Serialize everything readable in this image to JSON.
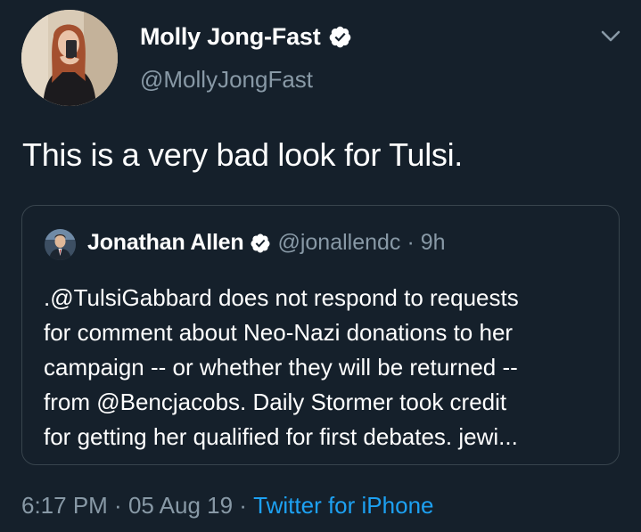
{
  "tweet": {
    "author": {
      "display_name": "Molly Jong-Fast",
      "handle": "@MollyJongFast",
      "verified_icon": "verified-badge-icon"
    },
    "text": "This is a very bad look for Tulsi.",
    "quoted": {
      "display_name": "Jonathan Allen",
      "handle": "@jonallendc",
      "separator": "·",
      "time": "9h",
      "lines": [
        ".@TulsiGabbard does not respond to requests",
        "for comment about Neo-Nazi donations to her",
        "campaign -- or whether they will be returned --",
        "from @Bencjacobs. Daily Stormer took credit",
        "for getting her qualified for first debates. jewi..."
      ]
    },
    "meta": {
      "time": "6:17 PM",
      "sep1": " · ",
      "date": "05 Aug 19",
      "sep2": " · ",
      "source": "Twitter for iPhone"
    }
  },
  "colors": {
    "background": "#15202b",
    "text": "#ffffff",
    "muted": "#8899a6",
    "link": "#1da1f2",
    "border": "#38444d"
  },
  "icons": {
    "menu": "chevron-down-icon",
    "verified": "verified-badge-icon"
  }
}
